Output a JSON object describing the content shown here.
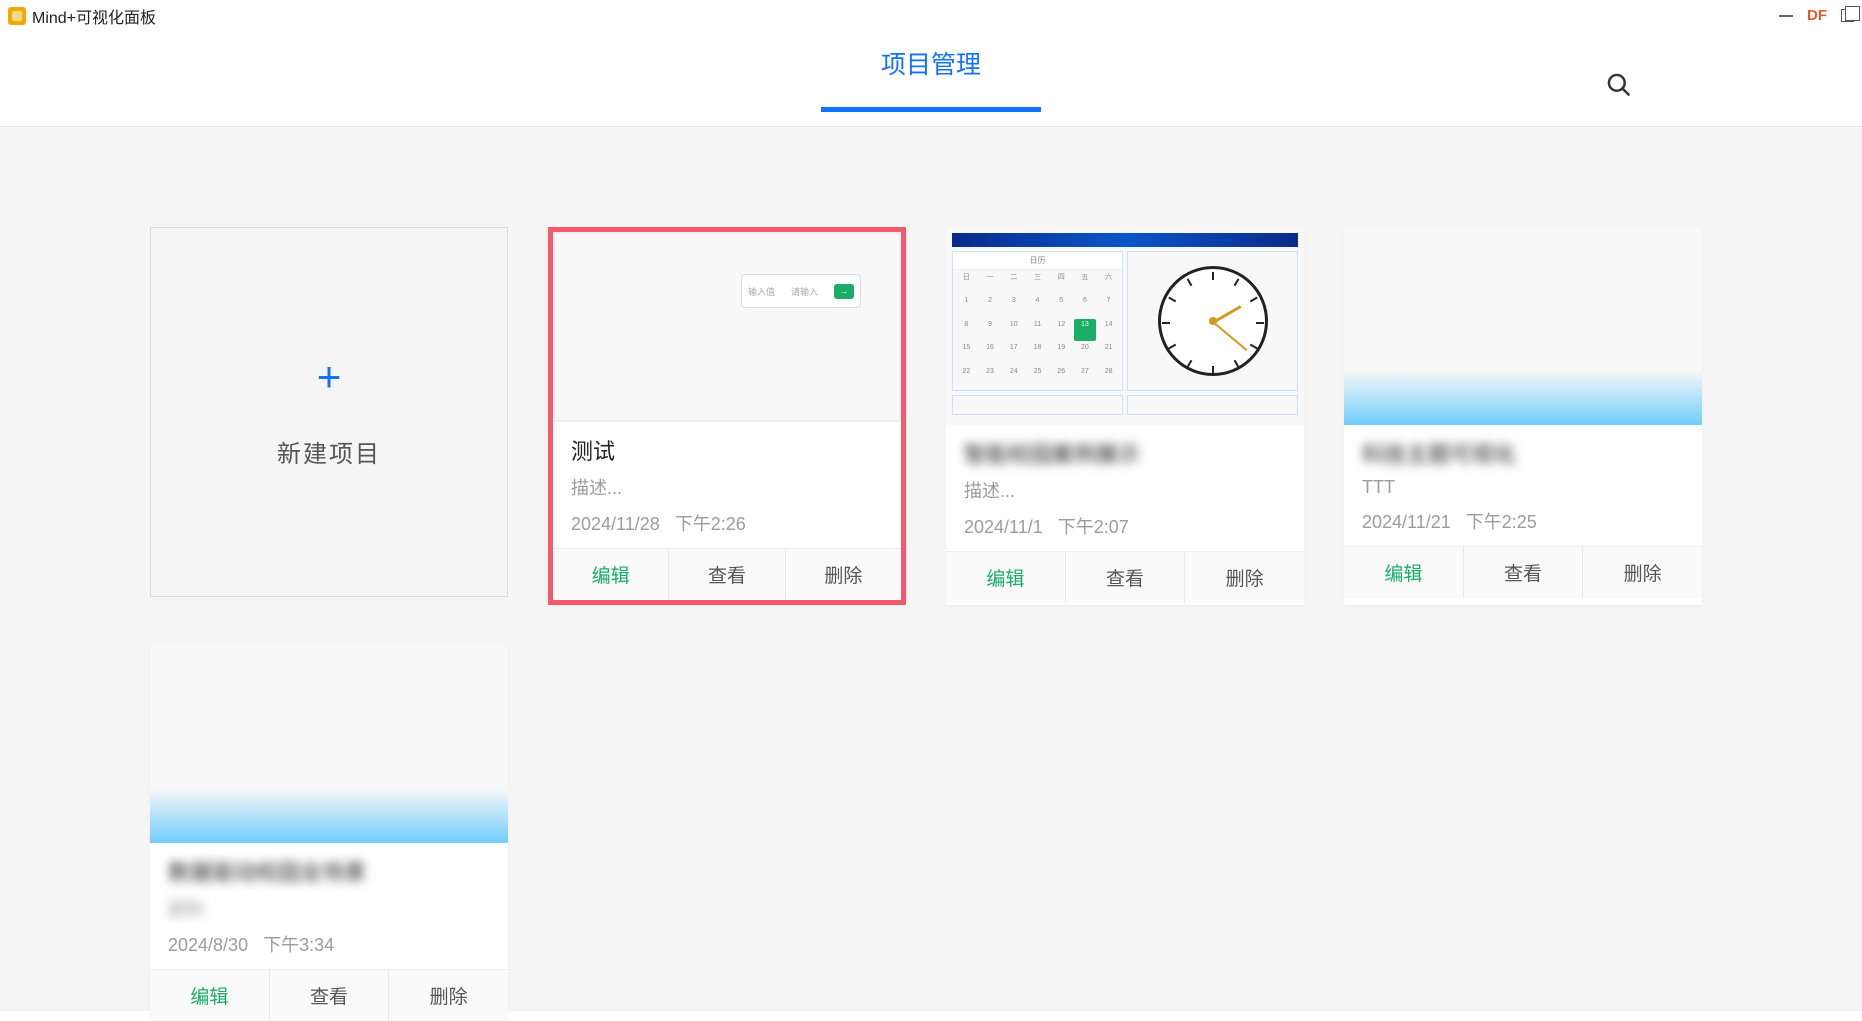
{
  "window": {
    "title": "Mind+可视化面板"
  },
  "titlebar": {
    "df_label": "DF"
  },
  "tabs": {
    "project_management": "项目管理"
  },
  "new_project": {
    "label": "新建项目"
  },
  "actions": {
    "edit": "编辑",
    "view": "查看",
    "delete": "删除"
  },
  "projects": [
    {
      "title": "测试",
      "description": "描述...",
      "date": "2024/11/28",
      "time": "下午2:26",
      "thumb_type": "grid",
      "selected": true,
      "title_blurred": false,
      "desc_blurred": false
    },
    {
      "title": "智能校园案例展示",
      "description": "描述...",
      "date": "2024/11/1",
      "time": "下午2:07",
      "thumb_type": "dashboard",
      "selected": false,
      "title_blurred": true,
      "desc_blurred": false
    },
    {
      "title": "科技主题可视化",
      "description": "TTT",
      "date": "2024/11/21",
      "time": "下午2:25",
      "thumb_type": "blue",
      "selected": false,
      "title_blurred": true,
      "desc_blurred": false
    },
    {
      "title": "数据驱动校园全场景",
      "description": "副标",
      "date": "2024/8/30",
      "time": "下午3:34",
      "thumb_type": "blue",
      "selected": false,
      "title_blurred": true,
      "desc_blurred": true
    }
  ],
  "thumb_grid_chip": {
    "label": "输入值",
    "placeholder": "请输入",
    "ok": "→"
  }
}
